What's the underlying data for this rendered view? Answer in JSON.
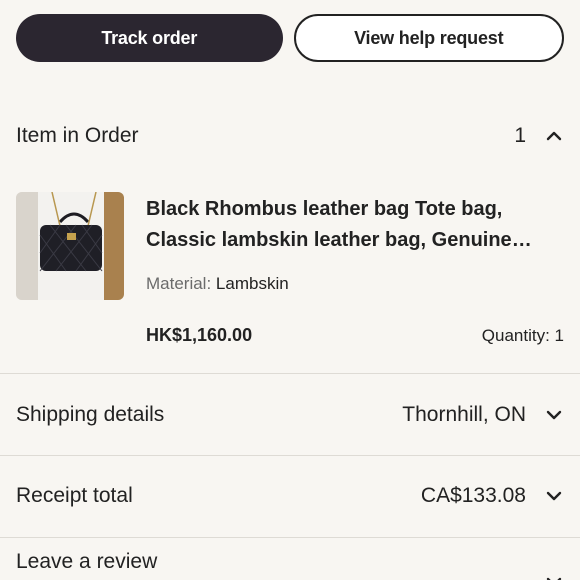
{
  "actions": {
    "track_order_label": "Track order",
    "view_help_label": "View help request"
  },
  "order_items": {
    "header": "Item in Order",
    "count": "1"
  },
  "item": {
    "title": "Black Rhombus leather bag Tote bag, Classic lambskin leather bag, Genuine leather bag",
    "attr_key": "Material:",
    "attr_value": "Lambskin",
    "price": "HK$1,160.00",
    "quantity": "Quantity: 1"
  },
  "shipping": {
    "label": "Shipping details",
    "value": "Thornhill, ON"
  },
  "receipt": {
    "label": "Receipt total",
    "value": "CA$133.08"
  },
  "review": {
    "label": "Leave a review"
  },
  "colors": {
    "primary_button": "#2b2630",
    "background": "#f8f6f2",
    "divider": "#dedbd5"
  }
}
